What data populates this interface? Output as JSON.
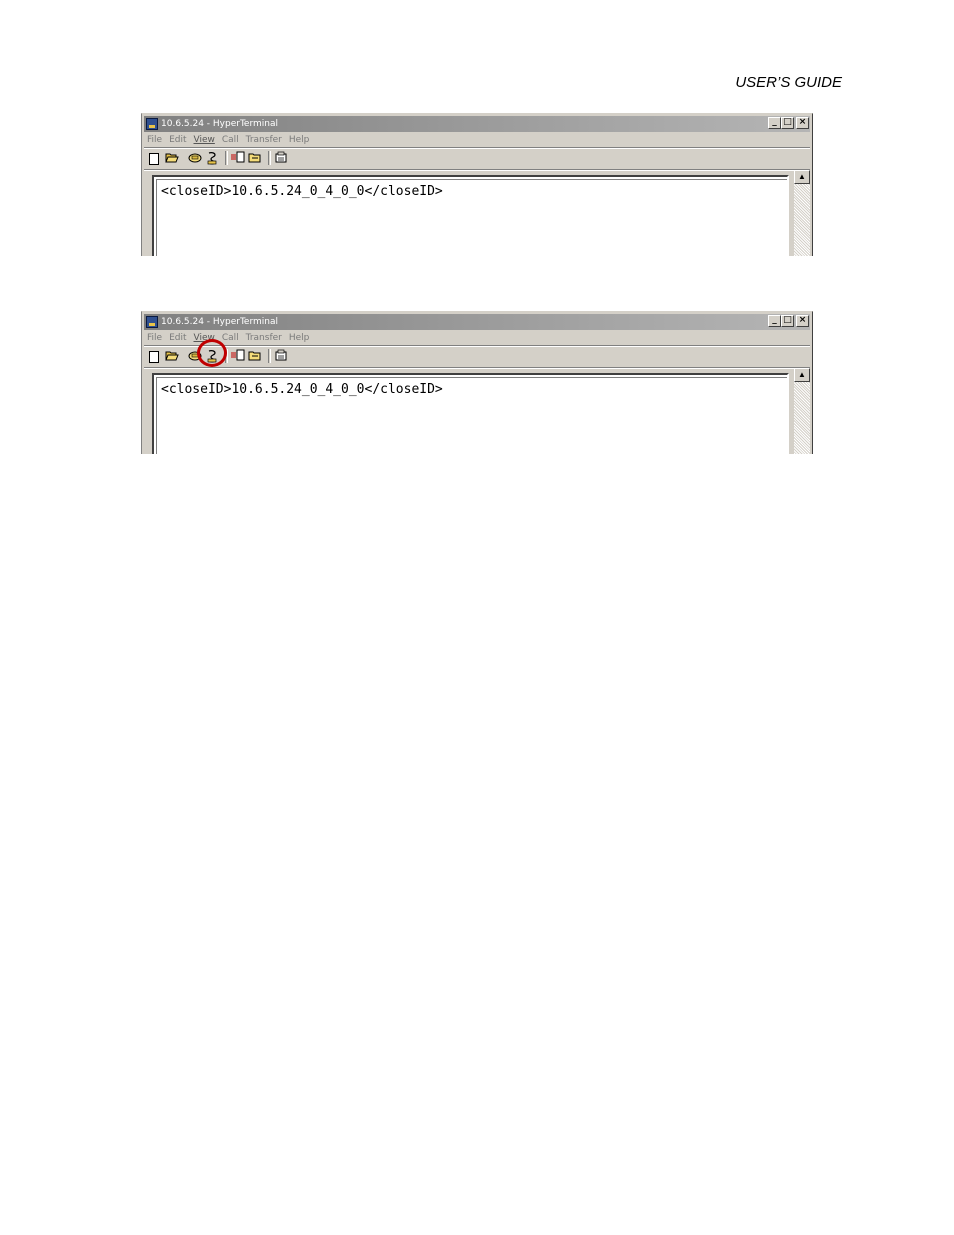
{
  "header": {
    "text": "USER’S GUIDE"
  },
  "windows": [
    {
      "title": "10.6.5.24 - HyperTerminal",
      "menu": [
        "File",
        "Edit",
        "View",
        "Call",
        "Transfer",
        "Help"
      ],
      "buttons": {
        "minimize": "_",
        "maximize": "□",
        "close": "×"
      },
      "terminal_text": "<closeID>10.6.5.24_0_4_0_0</closeID>",
      "scroll_up": "▲",
      "icons": [
        "new-icon",
        "open-icon",
        "dial-icon",
        "disconnect-icon",
        "send-icon",
        "receive-icon",
        "properties-icon"
      ],
      "highlight_disconnect": false
    },
    {
      "title": "10.6.5.24 - HyperTerminal",
      "menu": [
        "File",
        "Edit",
        "View",
        "Call",
        "Transfer",
        "Help"
      ],
      "buttons": {
        "minimize": "_",
        "maximize": "□",
        "close": "×"
      },
      "terminal_text": "<closeID>10.6.5.24_0_4_0_0</closeID>",
      "scroll_up": "▲",
      "icons": [
        "new-icon",
        "open-icon",
        "dial-icon",
        "disconnect-icon",
        "send-icon",
        "receive-icon",
        "properties-icon"
      ],
      "highlight_disconnect": true,
      "highlight_color": "#c00000"
    }
  ]
}
